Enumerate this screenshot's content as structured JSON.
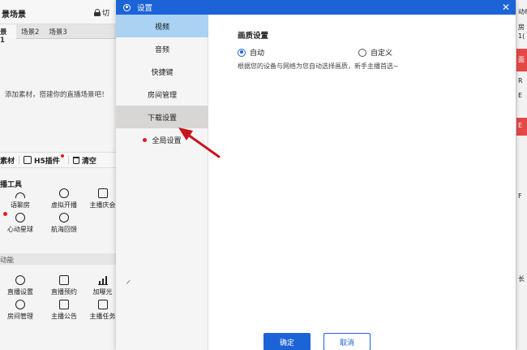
{
  "background": {
    "header_title": "景场景",
    "switch_label": "切",
    "scene_tabs": [
      "景1",
      "场景2",
      "场景3"
    ],
    "empty_hint": "添加素材，搭建你的直播场景吧！",
    "material_bar": {
      "material": "素材",
      "h5": "H5插件",
      "clear": "清空"
    },
    "tools_label": "播工具",
    "tools": [
      {
        "label": "语聊房",
        "icon": "arc-icon",
        "dot": false
      },
      {
        "label": "虚拟开播",
        "icon": "mask-icon",
        "dot": false
      },
      {
        "label": "主播庆会",
        "icon": "check-icon",
        "dot": false
      },
      {
        "label": "心动星球",
        "icon": "planet-icon",
        "dot": true
      },
      {
        "label": "航海回馈",
        "icon": "anchor-icon",
        "dot": false
      }
    ],
    "features_label": "动能",
    "features": [
      {
        "label": "直播设置",
        "icon": "settings-icon"
      },
      {
        "label": "直播预约",
        "icon": "calendar-icon"
      },
      {
        "label": "加曝光",
        "icon": "chart-icon"
      },
      {
        "label": "房间管理",
        "icon": "user-icon"
      },
      {
        "label": "主播公告",
        "icon": "notice-icon"
      },
      {
        "label": "主播任务",
        "icon": "task-icon"
      }
    ],
    "right_texts": [
      "动&",
      "房",
      "1(",
      "面",
      "R",
      "E",
      "E",
      "F",
      "长"
    ]
  },
  "dialog": {
    "title": "设置",
    "nav": [
      {
        "label": "视频",
        "state": "active",
        "dot": false
      },
      {
        "label": "音频",
        "state": "normal",
        "dot": false
      },
      {
        "label": "快捷键",
        "state": "normal",
        "dot": false
      },
      {
        "label": "房间管理",
        "state": "normal",
        "dot": false
      },
      {
        "label": "下载设置",
        "state": "hover",
        "dot": false
      },
      {
        "label": "全局设置",
        "state": "normal",
        "dot": true
      }
    ],
    "content": {
      "section_title": "画质设置",
      "options": [
        {
          "label": "自动",
          "checked": true
        },
        {
          "label": "自定义",
          "checked": false
        }
      ],
      "hint": "根据您的设备与网络为您自动选择画质，新手主播首选~"
    },
    "buttons": {
      "confirm": "确定",
      "cancel": "取消"
    }
  },
  "colors": {
    "accent": "#1d63d8",
    "nav_active": "#a9d2f3",
    "nav_hover": "#d8d6d4",
    "dot_red": "#e01e1e",
    "annotation_arrow": "#c8141e"
  }
}
